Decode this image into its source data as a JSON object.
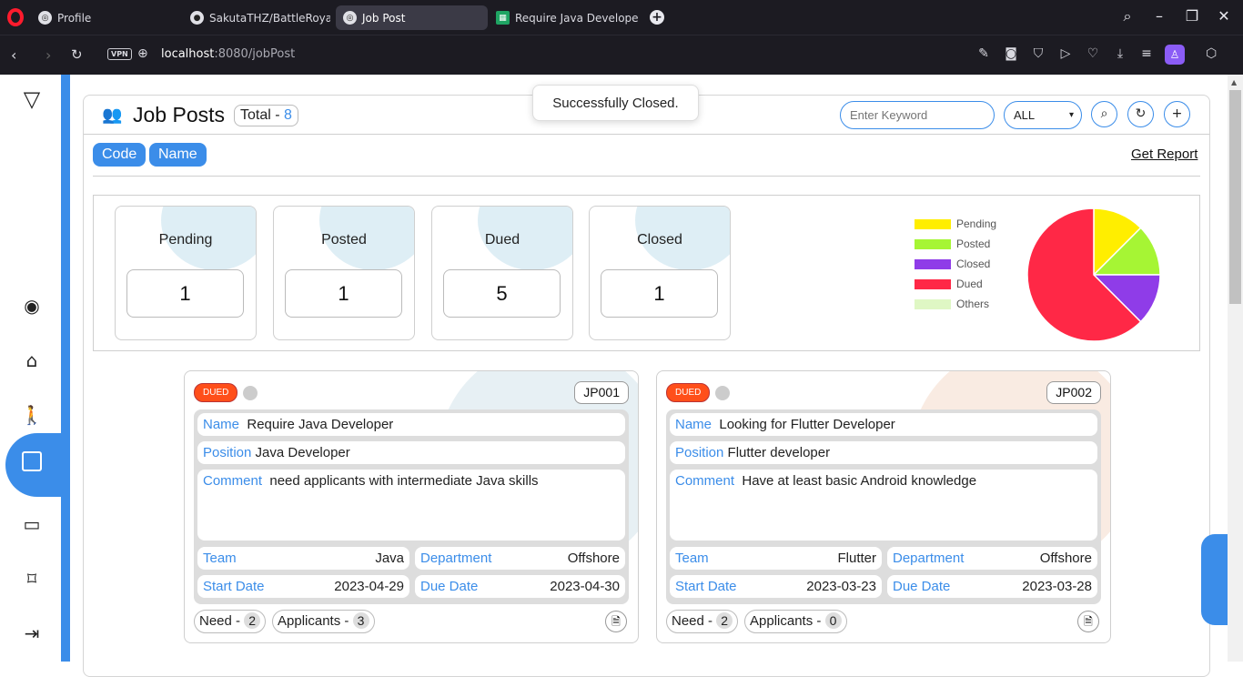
{
  "browser": {
    "tabs": [
      {
        "label": "Profile",
        "active": false
      },
      {
        "label": "SakutaTHZ/BattleRoyale: ",
        "active": false
      },
      {
        "label": "Job Post",
        "active": true
      },
      {
        "label": "Require Java Developer (F",
        "active": false
      }
    ],
    "vpn_label": "VPN",
    "url_host": "localhost",
    "url_path": ":8080/jobPost"
  },
  "toast": "Successfully Closed.",
  "header": {
    "title": "Job Posts",
    "total_label": "Total - ",
    "total_value": "8",
    "keyword_placeholder": "Enter Keyword",
    "filter_selected": "ALL",
    "sort_buttons": [
      "Code",
      "Name"
    ],
    "report_link": "Get Report"
  },
  "stats": [
    {
      "label": "Pending",
      "value": "1"
    },
    {
      "label": "Posted",
      "value": "1"
    },
    {
      "label": "Dued",
      "value": "5"
    },
    {
      "label": "Closed",
      "value": "1"
    }
  ],
  "chart_data": {
    "type": "pie",
    "title": "",
    "legend_position": "left",
    "categories": [
      "Pending",
      "Posted",
      "Closed",
      "Dued",
      "Others"
    ],
    "values": [
      1,
      1,
      1,
      5,
      0
    ],
    "colors": [
      "#ffee00",
      "#a6f534",
      "#8f3ce8",
      "#ff2846",
      "#dff7c4"
    ]
  },
  "cards": [
    {
      "status": "DUED",
      "code": "JP001",
      "name_label": "Name",
      "name": "Require Java Developer",
      "position_label": "Position",
      "position": "Java Developer",
      "comment_label": "Comment",
      "comment": "need applicants with intermediate Java skills",
      "team_label": "Team",
      "team": "Java",
      "department_label": "Department",
      "department": "Offshore",
      "start_label": "Start Date",
      "start": "2023-04-29",
      "due_label": "Due Date",
      "due": "2023-04-30",
      "need_label": "Need - ",
      "need": "2",
      "applicants_label": "Applicants - ",
      "applicants": "3"
    },
    {
      "status": "DUED",
      "code": "JP002",
      "name_label": "Name",
      "name": "Looking for Flutter Developer",
      "position_label": "Position",
      "position": "Flutter developer",
      "comment_label": "Comment",
      "comment": "Have at least basic Android knowledge",
      "team_label": "Team",
      "team": "Flutter",
      "department_label": "Department",
      "department": "Offshore",
      "start_label": "Start Date",
      "start": "2023-03-23",
      "due_label": "Due Date",
      "due": "2023-03-28",
      "need_label": "Need - ",
      "need": "2",
      "applicants_label": "Applicants - ",
      "applicants": "0"
    }
  ]
}
